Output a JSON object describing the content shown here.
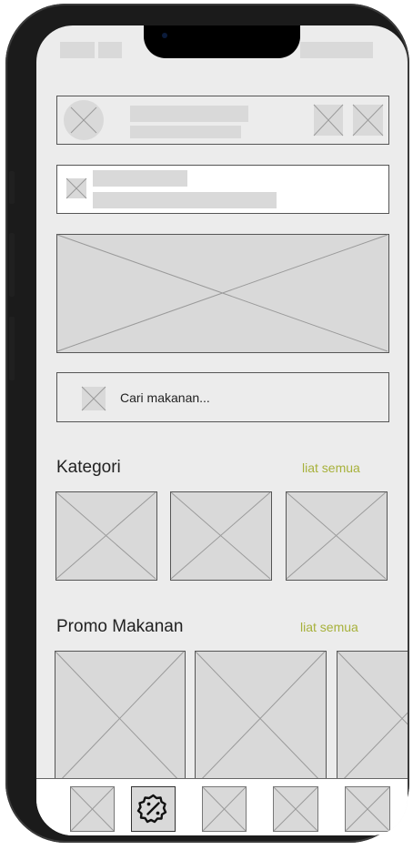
{
  "search": {
    "placeholder": "Cari makanan..."
  },
  "categories": {
    "title": "Kategori",
    "see_all": "liat semua"
  },
  "promos": {
    "title": "Promo Makanan",
    "see_all": "liat semua"
  },
  "bottom_nav": {
    "items": [
      "placeholder-icon",
      "promo-badge-icon",
      "placeholder-icon",
      "placeholder-icon",
      "placeholder-icon"
    ],
    "active_index": 1
  },
  "colors": {
    "accent": "#a7b13b",
    "placeholder": "#d9d9d9",
    "screen": "#ececec",
    "frame": "#1b1b1b"
  }
}
